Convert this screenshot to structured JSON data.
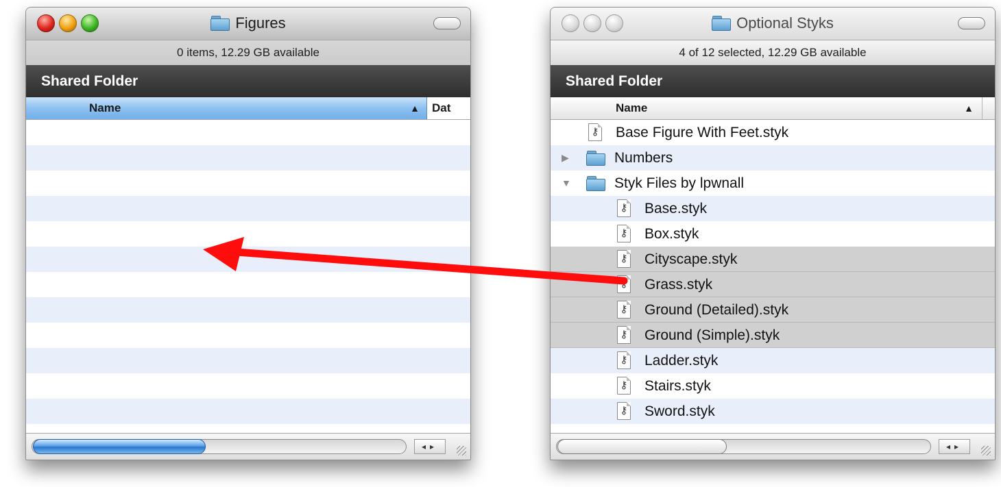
{
  "left_window": {
    "title": "Figures",
    "status": "0 items, 12.29 GB available",
    "shared_header": "Shared Folder",
    "col_name": "Name",
    "col_date": "Dat",
    "sort_arrow": "▲",
    "scroll_arrows": "◂▸"
  },
  "right_window": {
    "title": "Optional Styks",
    "status": "4 of 12 selected, 12.29 GB available",
    "shared_header": "Shared Folder",
    "col_name": "Name",
    "sort_arrow": "▲",
    "scroll_arrows": "◂▸",
    "items": [
      {
        "label": "Base Figure With Feet.styk",
        "type": "file",
        "level": 0,
        "selected": false
      },
      {
        "label": "Numbers",
        "type": "folder",
        "level": 0,
        "expanded": false,
        "disclosure": "▶",
        "selected": false
      },
      {
        "label": "Styk Files by lpwnall",
        "type": "folder",
        "level": 0,
        "expanded": true,
        "disclosure": "▼",
        "selected": false
      },
      {
        "label": "Base.styk",
        "type": "file",
        "level": 1,
        "selected": false
      },
      {
        "label": "Box.styk",
        "type": "file",
        "level": 1,
        "selected": false
      },
      {
        "label": "Cityscape.styk",
        "type": "file",
        "level": 1,
        "selected": true
      },
      {
        "label": "Grass.styk",
        "type": "file",
        "level": 1,
        "selected": true
      },
      {
        "label": "Ground (Detailed).styk",
        "type": "file",
        "level": 1,
        "selected": true
      },
      {
        "label": "Ground (Simple).styk",
        "type": "file",
        "level": 1,
        "selected": true
      },
      {
        "label": "Ladder.styk",
        "type": "file",
        "level": 1,
        "selected": false
      },
      {
        "label": "Stairs.styk",
        "type": "file",
        "level": 1,
        "selected": false
      },
      {
        "label": "Sword.styk",
        "type": "file",
        "level": 1,
        "selected": false
      }
    ]
  },
  "icons": {
    "file": "figure-file-icon",
    "folder": "folder-icon",
    "figure_glyph": "🯅"
  },
  "colors": {
    "drag_arrow": "#ff0d0d",
    "selection": "#d0d0d0",
    "stripe": "#e8effb"
  }
}
